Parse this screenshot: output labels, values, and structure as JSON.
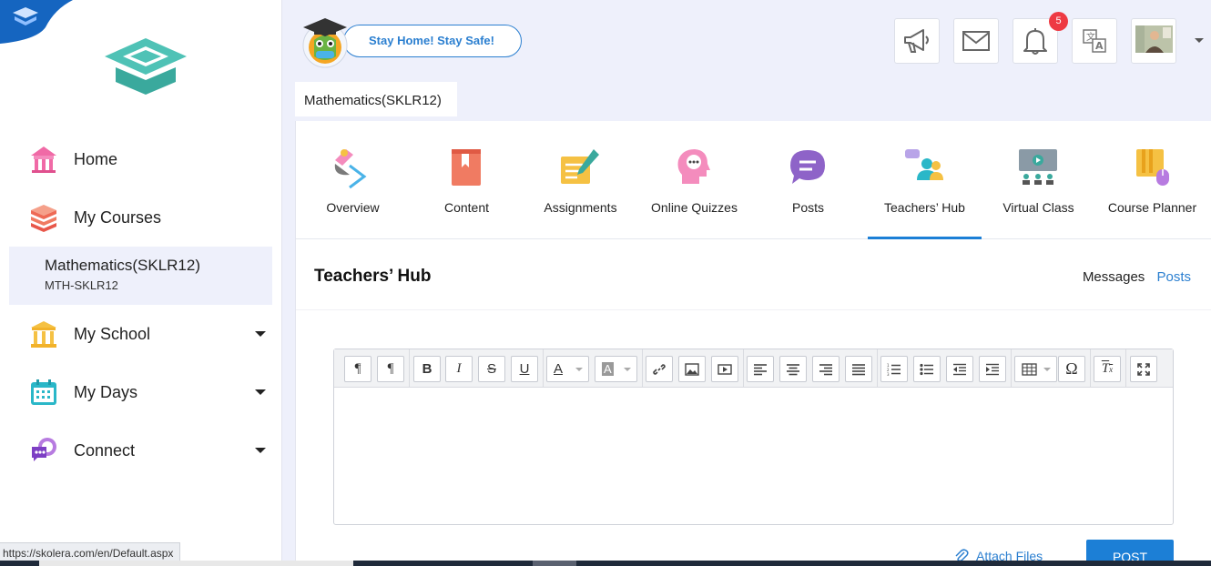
{
  "sidebar": {
    "items": [
      {
        "label": "Home"
      },
      {
        "label": "My Courses"
      },
      {
        "label": "My School"
      },
      {
        "label": "My Days"
      },
      {
        "label": "Connect"
      }
    ],
    "selected_course": {
      "name": "Mathematics(SKLR12)",
      "code": "MTH-SKLR12"
    }
  },
  "status_url": "https://skolera.com/en/Default.aspx",
  "header": {
    "banner_text": "Stay Home! Stay Safe!",
    "notification_count": "5",
    "breadcrumb": "Mathematics(SKLR12)"
  },
  "tabs": [
    {
      "label": "Overview"
    },
    {
      "label": "Content"
    },
    {
      "label": "Assignments"
    },
    {
      "label": "Online Quizzes"
    },
    {
      "label": "Posts"
    },
    {
      "label": "Teachers’ Hub"
    },
    {
      "label": "Virtual Class"
    },
    {
      "label": "Course Planner"
    }
  ],
  "hub": {
    "title": "Teachers’ Hub",
    "messages_link": "Messages",
    "posts_link": "Posts"
  },
  "editor": {
    "attach_label": "Attach Files",
    "post_label": "POST"
  },
  "colors": {
    "accent": "#1c7fd6",
    "badge": "#ee3a43",
    "background": "#eef0fb"
  }
}
